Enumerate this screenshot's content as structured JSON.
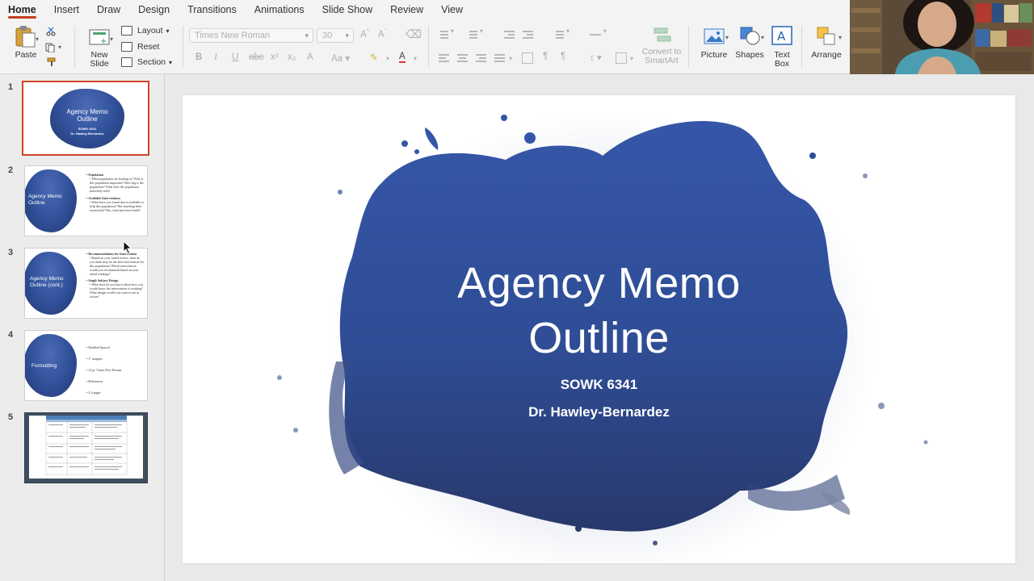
{
  "menu": {
    "tabs": [
      {
        "label": "Home",
        "active": true
      },
      {
        "label": "Insert",
        "active": false
      },
      {
        "label": "Draw",
        "active": false
      },
      {
        "label": "Design",
        "active": false
      },
      {
        "label": "Transitions",
        "active": false
      },
      {
        "label": "Animations",
        "active": false
      },
      {
        "label": "Slide Show",
        "active": false
      },
      {
        "label": "Review",
        "active": false
      },
      {
        "label": "View",
        "active": false
      }
    ]
  },
  "ribbon": {
    "paste_label": "Paste",
    "new_slide_label": "New\nSlide",
    "layout_label": "Layout",
    "reset_label": "Reset",
    "section_label": "Section",
    "font_name_placeholder": "Times New Roman",
    "font_size_placeholder": "30",
    "convert_label": "Convert to\nSmartArt",
    "picture_label": "Picture",
    "shapes_label": "Shapes",
    "textbox_label": "Text\nBox",
    "arrange_label": "Arrange",
    "accent_color": "#c43e1c"
  },
  "thumbnails": [
    {
      "number": "1",
      "title": "Agency Memo Outline",
      "sub1": "SOWK 6341",
      "sub2": "Dr. Hawley-Bernardez",
      "selected": true
    },
    {
      "number": "2",
      "title": "Agency Memo Outline",
      "bullets": [
        {
          "head": "• Population",
          "text": "• What population are looking at? Why is this population important? How big is the population? What does the population need help with?"
        },
        {
          "head": "• Available Interventions",
          "text": "• What have you found that is available to help this population? Has anything been researched? Has, what has been found?"
        }
      ]
    },
    {
      "number": "3",
      "title": "Agency Memo Outline (cont.)",
      "bullets": [
        {
          "head": "• Recommendations for Intervention",
          "text": "• Based on your initial review, what do you think may be the best intervention for this population? Which intervention would you recommend based on your initial readings?"
        },
        {
          "head": "• Single Subject Design",
          "text": "• What does do you know about how you would know the intervention is working? What design would you want to use in action?"
        }
      ]
    },
    {
      "number": "4",
      "title": "Formatting",
      "items": [
        "• Doubled Spaced",
        "• 1\" margins",
        "• 12 pt. Times New Roman",
        "• References",
        "• 3-4 pages"
      ]
    },
    {
      "number": "5",
      "dark": true
    }
  ],
  "slide": {
    "title_line1": "Agency Memo",
    "title_line2": "Outline",
    "subtitle_line1": "SOWK 6341",
    "subtitle_line2": "Dr. Hawley-Bernardez",
    "blob_color": "#2f4f98"
  }
}
